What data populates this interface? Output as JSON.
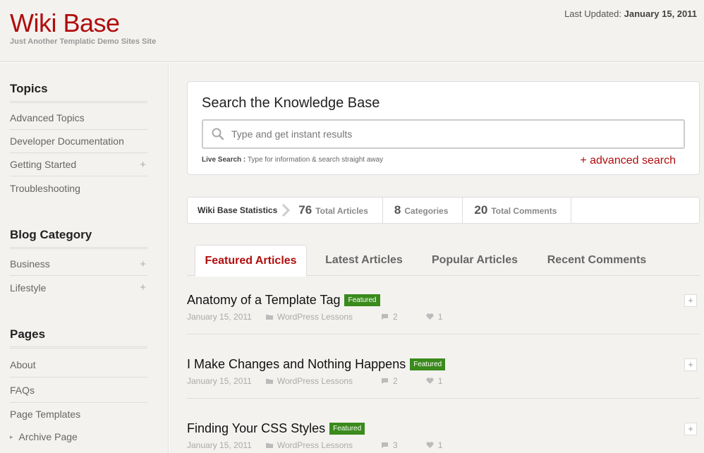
{
  "header": {
    "site_title": "Wiki Base",
    "tagline": "Just Another Templatic Demo Sites Site",
    "last_updated_label": "Last Updated:",
    "last_updated_date": "January 15, 2011"
  },
  "sidebar": {
    "topics": {
      "heading": "Topics",
      "items": [
        {
          "label": "Advanced Topics"
        },
        {
          "label": "Developer Documentation"
        },
        {
          "label": "Getting Started",
          "expand": "+"
        },
        {
          "label": "Troubleshooting"
        }
      ]
    },
    "blog": {
      "heading": "Blog Category",
      "items": [
        {
          "label": "Business",
          "expand": "+"
        },
        {
          "label": "Lifestyle",
          "expand": "+"
        }
      ]
    },
    "pages": {
      "heading": "Pages",
      "items": [
        {
          "label": "About"
        },
        {
          "label": "FAQs"
        },
        {
          "label": "Page Templates"
        },
        {
          "label": "Archive Page",
          "marker": "▸"
        }
      ]
    }
  },
  "search": {
    "title": "Search the Knowledge Base",
    "placeholder": "Type and get instant results",
    "live_label": "Live Search :",
    "live_text": "Type for information & search straight away",
    "advanced_link": "+ advanced search"
  },
  "stats": {
    "label": "Wiki Base Statistics",
    "articles_count": "76",
    "articles_label": "Total Articles",
    "categories_count": "8",
    "categories_label": "Categories",
    "comments_count": "20",
    "comments_label": "Total Comments"
  },
  "tabs": [
    {
      "label": "Featured Articles",
      "active": true
    },
    {
      "label": "Latest Articles"
    },
    {
      "label": "Popular Articles"
    },
    {
      "label": "Recent Comments"
    }
  ],
  "articles": [
    {
      "title": "Anatomy of a Template Tag",
      "badge": "Featured",
      "date": "January 15, 2011",
      "category": "WordPress Lessons",
      "comments": "2",
      "likes": "1",
      "expand": "+"
    },
    {
      "title": "I Make Changes and Nothing Happens",
      "badge": "Featured",
      "date": "January 15, 2011",
      "category": "WordPress Lessons",
      "comments": "2",
      "likes": "1",
      "expand": "+"
    },
    {
      "title": "Finding Your CSS Styles",
      "badge": "Featured",
      "date": "January 15, 2011",
      "category": "WordPress Lessons",
      "comments": "3",
      "likes": "1",
      "expand": "+"
    }
  ],
  "colors": {
    "brand": "#b00d0d",
    "badge": "#3a8a1c",
    "background": "#f3f2ef"
  },
  "icons": {
    "search": "magnifier-icon",
    "category": "folder-icon",
    "comments": "comment-bubble-icon",
    "likes": "heart-icon",
    "stats_arrow": "chevron-right-icon"
  }
}
